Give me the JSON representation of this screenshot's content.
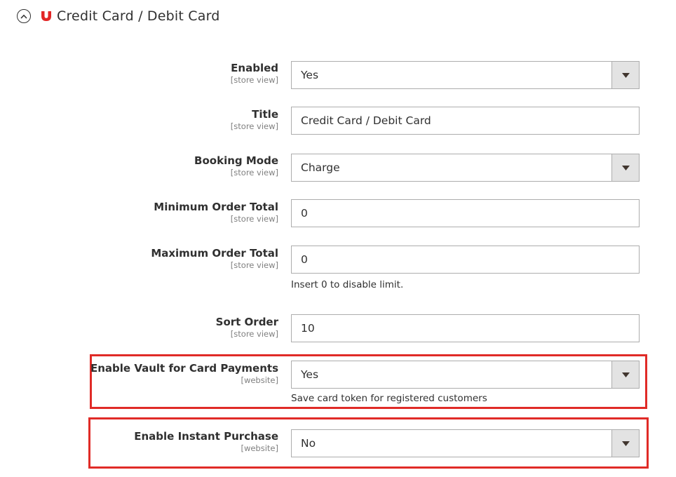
{
  "section": {
    "title": "Credit Card / Debit Card",
    "accent_color": "#e22626",
    "toggle_icon": "chevron-up-circle-icon",
    "brand_icon": "brand-logo-icon"
  },
  "fields": {
    "enabled": {
      "label": "Enabled",
      "scope": "[store view]",
      "value": "Yes",
      "type": "select"
    },
    "title": {
      "label": "Title",
      "scope": "[store view]",
      "value": "Credit Card / Debit Card",
      "type": "text"
    },
    "booking_mode": {
      "label": "Booking Mode",
      "scope": "[store view]",
      "value": "Charge",
      "type": "select"
    },
    "min_order_total": {
      "label": "Minimum Order Total",
      "scope": "[store view]",
      "value": "0",
      "type": "text"
    },
    "max_order_total": {
      "label": "Maximum Order Total",
      "scope": "[store view]",
      "value": "0",
      "type": "text",
      "note": "Insert 0 to disable limit."
    },
    "sort_order": {
      "label": "Sort Order",
      "scope": "[store view]",
      "value": "10",
      "type": "text"
    },
    "enable_vault": {
      "label": "Enable Vault for Card Payments",
      "scope": "[website]",
      "value": "Yes",
      "type": "select",
      "note": "Save card token for registered customers"
    },
    "enable_instant_purchase": {
      "label": "Enable Instant Purchase",
      "scope": "[website]",
      "value": "No",
      "type": "select"
    }
  },
  "highlight_color": "#e02b27"
}
